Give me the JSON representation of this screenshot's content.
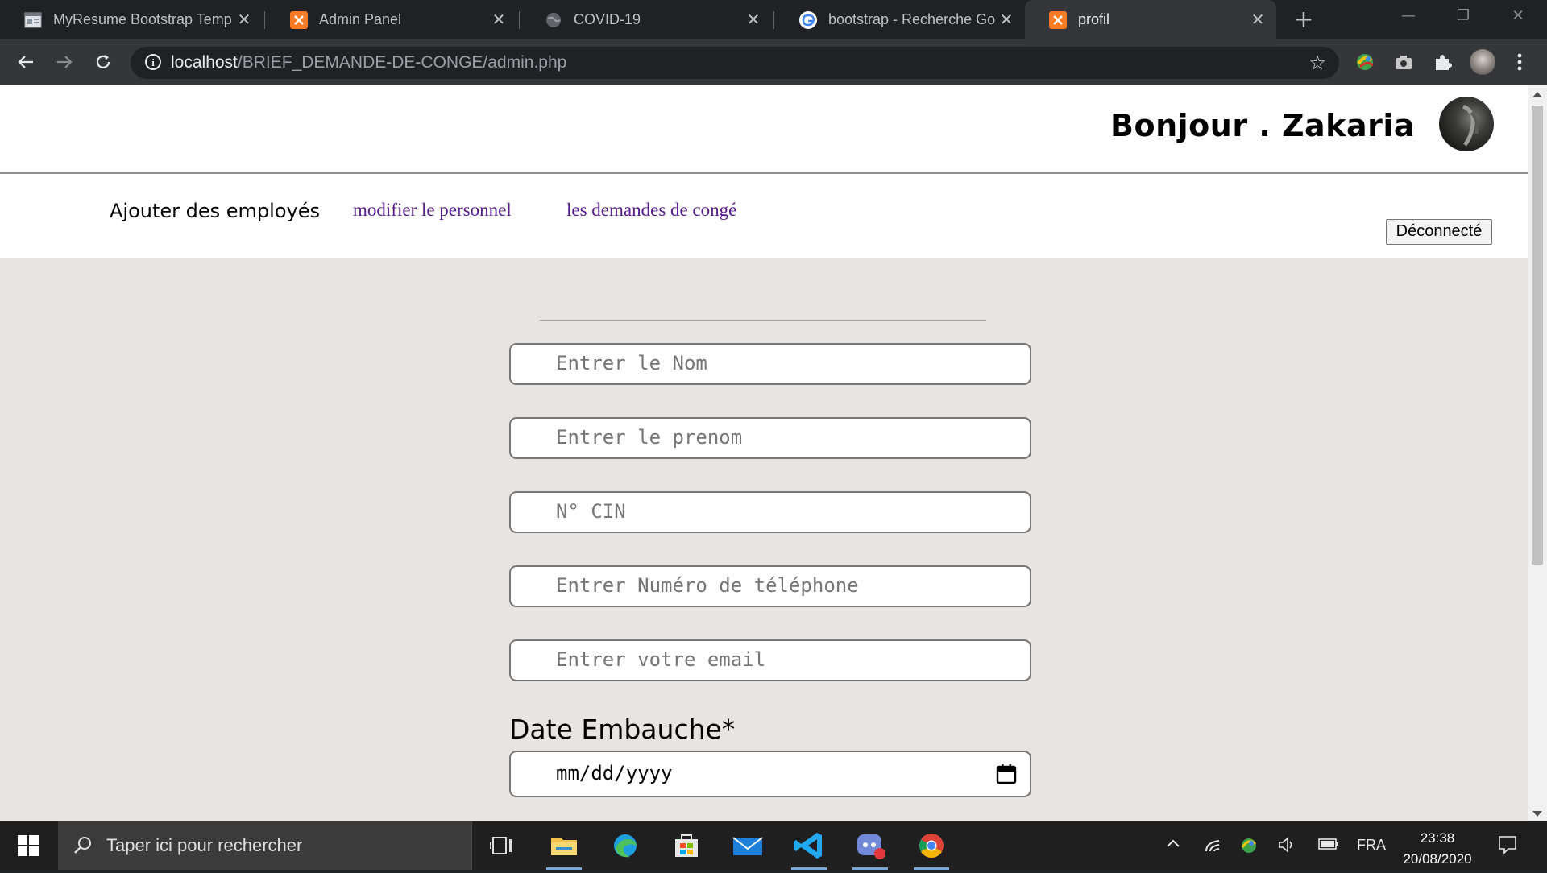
{
  "browser": {
    "tabs": [
      {
        "title": "MyResume Bootstrap Temp",
        "icon": "document-icon",
        "active": false
      },
      {
        "title": "Admin Panel",
        "icon": "xampp-icon",
        "active": false
      },
      {
        "title": "COVID-19",
        "icon": "globe-icon",
        "active": false
      },
      {
        "title": "bootstrap - Recherche Goo",
        "icon": "google-icon",
        "active": false
      },
      {
        "title": "profil",
        "icon": "xampp-icon",
        "active": true
      }
    ],
    "new_tab_label": "+",
    "url_host": "localhost",
    "url_path": "/BRIEF_DEMANDE-DE-CONGE/admin.php"
  },
  "header": {
    "greeting": "Bonjour . Zakaria"
  },
  "nav": {
    "current": "Ajouter des employés",
    "links": [
      "modifier le personnel",
      "les demandes de congé"
    ],
    "logout": "Déconnecté"
  },
  "form": {
    "fields": [
      {
        "placeholder": "Entrer le Nom"
      },
      {
        "placeholder": "Entrer le prenom"
      },
      {
        "placeholder": "N° CIN"
      },
      {
        "placeholder": "Entrer Numéro de téléphone"
      },
      {
        "placeholder": "Entrer votre email"
      }
    ],
    "date_label": "Date Embauche*",
    "date_placeholder": "mm/dd/yyyy"
  },
  "taskbar": {
    "search_placeholder": "Taper ici pour rechercher",
    "language": "FRA",
    "time": "23:38",
    "date": "20/08/2020",
    "apps": [
      "file-explorer-icon",
      "edge-icon",
      "store-icon",
      "mail-icon",
      "vscode-icon",
      "discord-icon",
      "chrome-icon"
    ]
  },
  "colors": {
    "page_bg": "#e8e4e1",
    "link": "#551a8b",
    "chrome_dark": "#202124",
    "chrome_toolbar": "#35363a",
    "taskbar": "#1f1f1f"
  }
}
